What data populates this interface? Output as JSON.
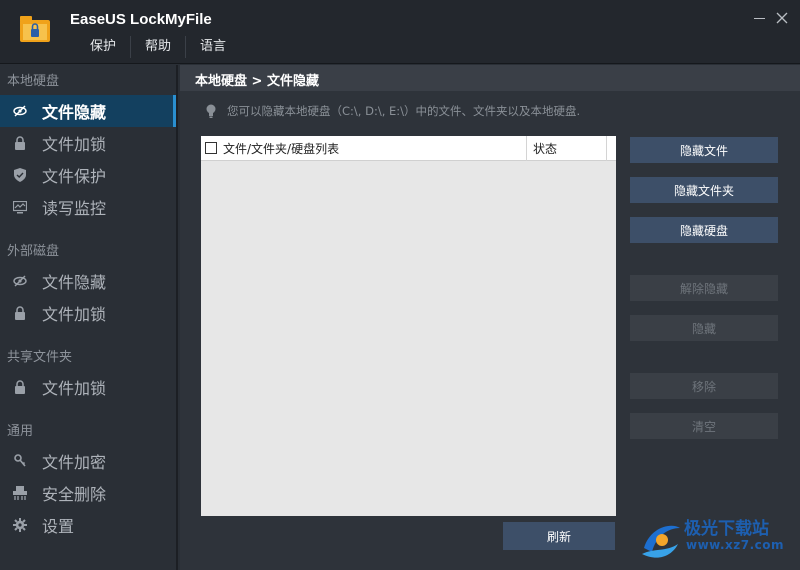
{
  "app": {
    "title": "EaseUS LockMyFile"
  },
  "menu": [
    "保护",
    "帮助",
    "语言"
  ],
  "sidebar": {
    "sections": [
      {
        "title": "本地硬盘",
        "items": [
          {
            "label": "文件隐藏",
            "icon": "eye-slash-icon",
            "active": true
          },
          {
            "label": "文件加锁",
            "icon": "lock-icon"
          },
          {
            "label": "文件保护",
            "icon": "shield-icon"
          },
          {
            "label": "读写监控",
            "icon": "monitor-icon"
          }
        ]
      },
      {
        "title": "外部磁盘",
        "items": [
          {
            "label": "文件隐藏",
            "icon": "eye-slash-icon"
          },
          {
            "label": "文件加锁",
            "icon": "lock-icon"
          }
        ]
      },
      {
        "title": "共享文件夹",
        "items": [
          {
            "label": "文件加锁",
            "icon": "lock-icon"
          }
        ]
      },
      {
        "title": "通用",
        "items": [
          {
            "label": "文件加密",
            "icon": "key-icon"
          },
          {
            "label": "安全删除",
            "icon": "shredder-icon"
          },
          {
            "label": "设置",
            "icon": "gear-icon"
          }
        ]
      }
    ]
  },
  "main": {
    "breadcrumb": "本地硬盘 > 文件隐藏",
    "hint": "您可以隐藏本地硬盘（C:\\, D:\\, E:\\）中的文件、文件夹以及本地硬盘.",
    "list": {
      "col_name": "文件/文件夹/硬盘列表",
      "col_status": "状态"
    },
    "buttons": {
      "hide_file": "隐藏文件",
      "hide_folder": "隐藏文件夹",
      "hide_drive": "隐藏硬盘",
      "unhide": "解除隐藏",
      "hide": "隐藏",
      "remove": "移除",
      "clear": "清空",
      "refresh": "刷新"
    }
  },
  "watermark": {
    "name": "极光下载站",
    "url": "www.xz7.com"
  },
  "colors": {
    "active_item": "#13405f",
    "button": "#3d4f68",
    "accent": "#2a8fd0"
  }
}
